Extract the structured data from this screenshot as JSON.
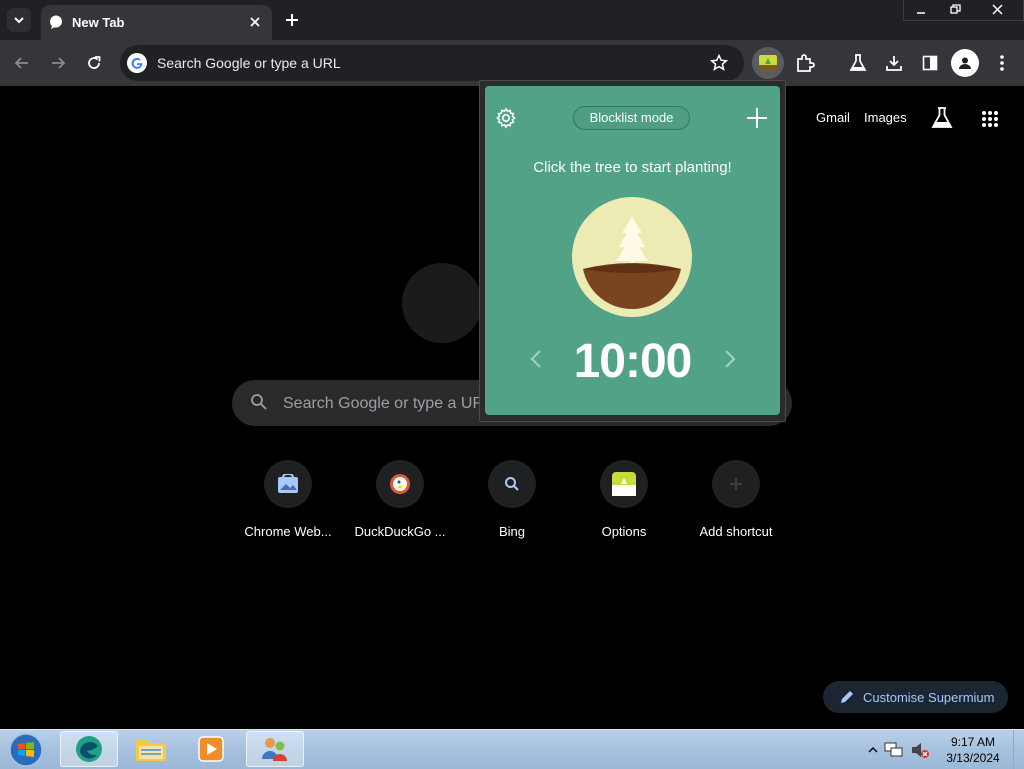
{
  "browser": {
    "tab": {
      "title": "New Tab"
    },
    "omnibox": {
      "placeholder": "Search Google or type a URL"
    }
  },
  "ntp": {
    "links": {
      "gmail": "Gmail",
      "images": "Images"
    },
    "search_placeholder": "Search Google or type a URL",
    "shortcuts": [
      {
        "label": "Chrome Web...",
        "icon": "chrome-web-store-icon"
      },
      {
        "label": "DuckDuckGo ...",
        "icon": "duckduckgo-icon"
      },
      {
        "label": "Bing",
        "icon": "search-icon"
      },
      {
        "label": "Options",
        "icon": "forest-icon"
      },
      {
        "label": "Add shortcut",
        "icon": "plus-icon"
      }
    ],
    "customise_label": "Customise Supermium"
  },
  "popup": {
    "mode": "Blocklist mode",
    "hint": "Click the tree to start planting!",
    "timer": "10:00"
  },
  "taskbar": {
    "time": "9:17 AM",
    "date": "3/13/2024"
  },
  "colors": {
    "popup_bg": "#51a287",
    "toolbar_bg": "#35363a",
    "tab_bg": "#35363a",
    "titlebar_bg": "#202124"
  }
}
